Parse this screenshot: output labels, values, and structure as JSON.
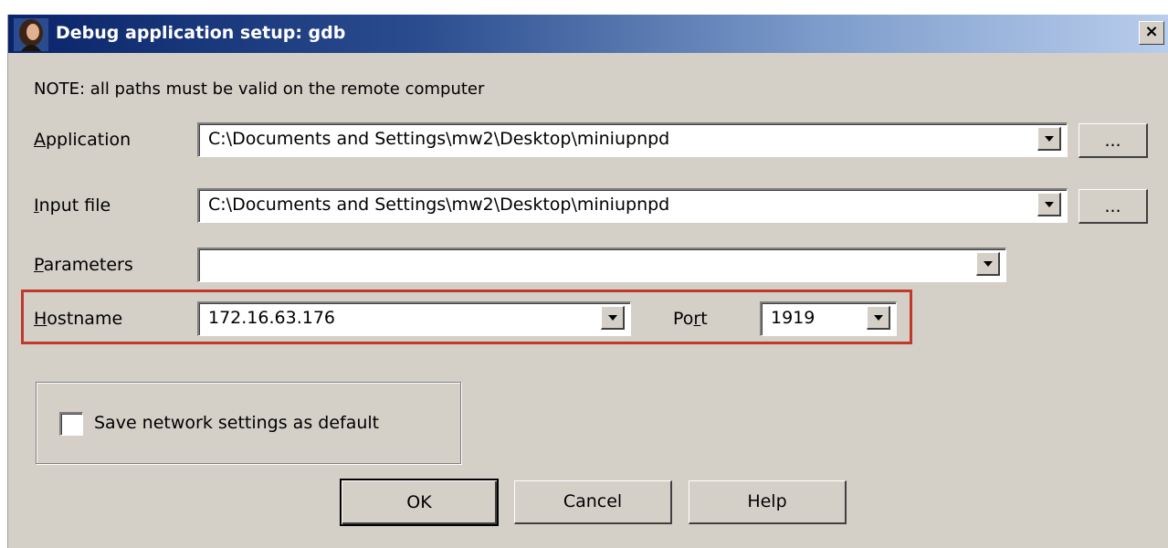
{
  "window": {
    "title": "Debug application setup: gdb",
    "close_label": "×"
  },
  "note": "NOTE: all paths must be valid on the remote computer",
  "fields": {
    "application": {
      "label_accel": "A",
      "label_rest": "pplication",
      "value": "C:\\Documents and Settings\\mw2\\Desktop\\miniupnpd",
      "browse_label": "..."
    },
    "input_file": {
      "label_accel": "I",
      "label_rest": "nput file",
      "value": "C:\\Documents and Settings\\mw2\\Desktop\\miniupnpd",
      "browse_label": "..."
    },
    "parameters": {
      "label_accel": "P",
      "label_rest": "arameters",
      "value": ""
    },
    "hostname": {
      "label_accel": "H",
      "label_rest": "ostname",
      "value": "172.16.63.176"
    },
    "port": {
      "label_pre": "Po",
      "label_accel": "r",
      "label_post": "t",
      "value": "1919"
    }
  },
  "save_default": {
    "label": "Save network settings as default",
    "checked": false
  },
  "buttons": {
    "ok": "OK",
    "cancel": "Cancel",
    "help": "Help"
  },
  "colors": {
    "dialog_bg": "#d4d0c8",
    "titlebar_start": "#0a246a",
    "titlebar_end": "#b9cdec",
    "highlight_border": "#c0392b"
  },
  "icons": [
    "app-portrait-icon",
    "close-icon",
    "dropdown-arrow-icon"
  ]
}
